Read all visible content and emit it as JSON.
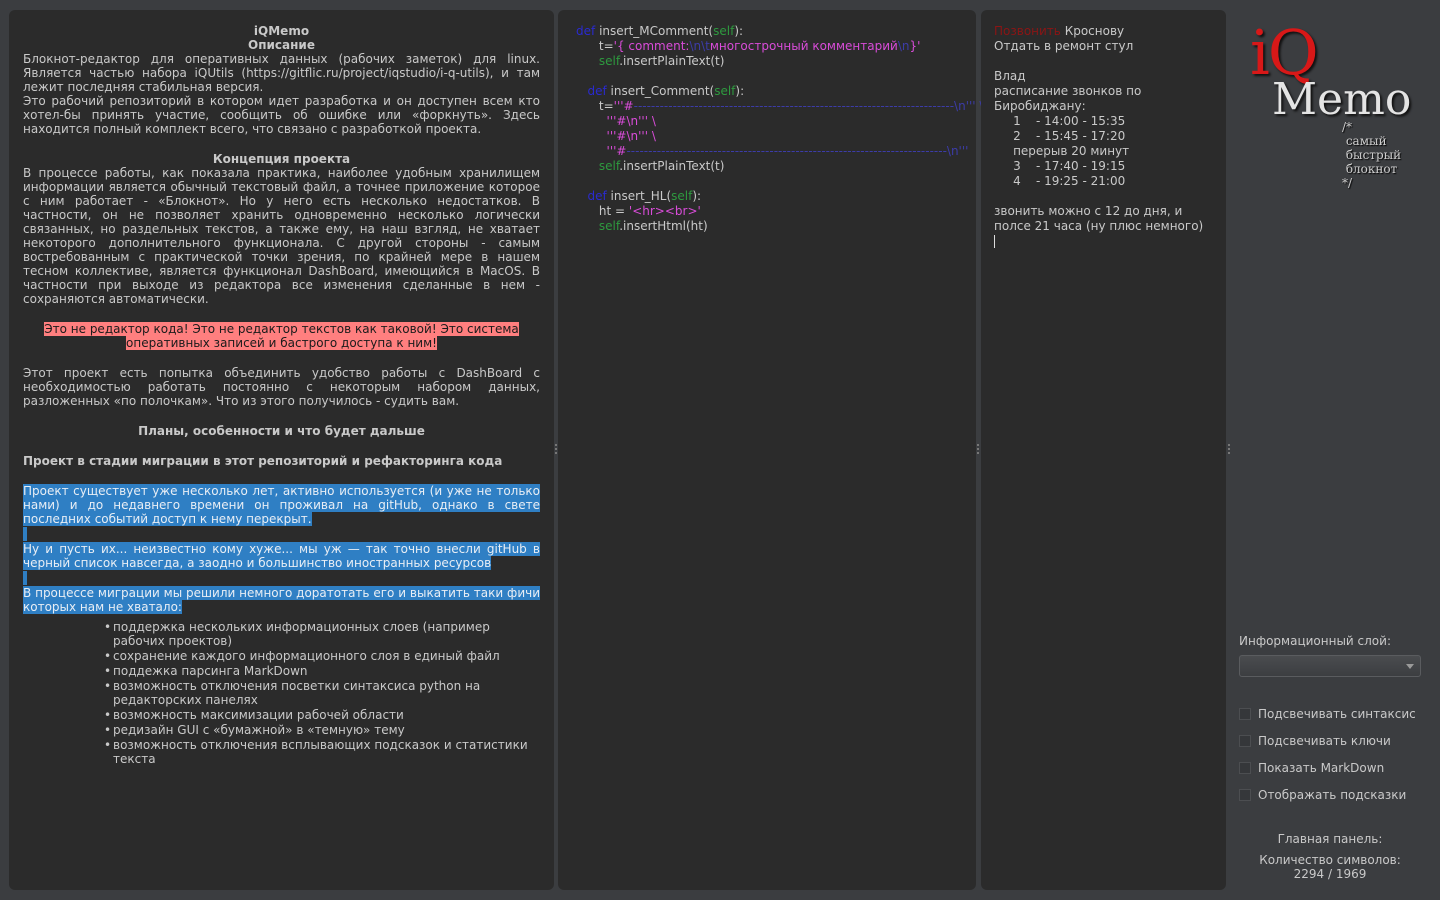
{
  "left_doc": {
    "title": "iQMemo",
    "desc_heading": "Описание",
    "desc_p1": "Блокнот-редактор для оперативных данных (рабочих заметок) для linux. Является частью набора iQUtils (https://gitflic.ru/project/iqstudio/i-q-utils), и там лежит последняя стабильная версия.",
    "desc_p2": "Это рабочий репозиторий в котором идет разработка и он доступен всем кто хотел-бы принять участие, сообщить об ошибке или «форкнуть». Здесь находится полный комплект всего, что связано с разработкой проекта.",
    "concept_heading": "Концепция проекта",
    "concept_p": "В процессе работы, как показала практика, наиболее удобным хранилищем информации является обычный текстовый файл, а точнее приложение которое с ним работает - «Блокнот». Но у него есть несколько недостатков. В частности, он не позволяет хранить одновременно несколько логически связанных, но раздельных текстов, а также ему, на наш взгляд, не хватает некоторого дополнительного функционала. С другой стороны - самым востребованным с практической точки зрения, по крайней мере в нашем тесном коллективе, является функционал DashBoard, имеющийся в MacOS. В частности при выходе из редактора все изменения сделанные в нем - сохраняются автоматически.",
    "warn_line1": "Это не редактор кода! Это не редактор текстов как таковой! Это система",
    "warn_line2": "оперативных записей и бастрого доступа к ним!",
    "unite_p": "Этот проект есть попытка объединить удобство работы с DashBoard с необходимостью работать постоянно с некоторым набором данных, разложенных «по полочкам». Что из этого получилось - судить вам.",
    "plans_heading": "Планы, особенности и что будет дальше",
    "migration_heading": "Проект в стадии миграции в этот репозиторий и рефакторинга кода",
    "sel_p1": "Проект существует уже несколько лет, активно используется (и уже не только нами) и до недавнего времени он проживал на gitHub, однако в свете последних событий доступ к нему перекрыт.",
    "sel_p2": "Ну и пусть их... неизвестно кому хуже... мы уж — так точно внесли gitHub в черный список навсегда, а заодно и большинство иностранных ресурсов",
    "sel_p3": "В процессе миграции мы решили немного доратотать его и выкатить таки фичи которых нам не хватало:",
    "features": [
      "поддержка нескольких информационных слоев (например рабочих проектов)",
      "сохранение каждого информационного слоя в единый файл",
      "поддежка парсинга MarkDown",
      "возможность отключения посветки синтаксиса python на редакторских панелях",
      "возможность максимизации рабочей области",
      "редизайн GUI с «бумажной» в «темную» тему",
      "возможность отключения всплывающих подсказок и статистики текста"
    ]
  },
  "code": {
    "def": "def",
    "self": "self",
    "fn1": "insert_MComment(",
    "fn1_close": "):",
    "l2_pre": "t=",
    "l2_q1": "'{ comment:",
    "l2_nt": "\\n\\t",
    "l2_text": "многострочный комментарий",
    "l2_n": "\\n",
    "l2_q2": "}'",
    "l3": ".insertPlainText(t)",
    "fn2": "insert_Comment(",
    "l5_pre": "t=",
    "l5_str": "'''#",
    "l5_rule": "--------------------------------------------------------------------------",
    "l5_end": "\\n''' \\",
    "l6": "'''#\\n''' \\",
    "l7": "'''#\\n''' \\",
    "l8_str": "'''#",
    "l8_rule": "--------------------------------------------------------------------------",
    "l8_end": "\\n'''",
    "fn3": "insert_HL(",
    "l11_pre": "ht = ",
    "l11_str": "'<hr><br>'",
    "l12": ".insertHtml(ht)"
  },
  "notes": {
    "l1_red": "Позвонить",
    "l1_rest": " Кроснову",
    "l2": "Отдать в ремонт стул",
    "l3": "Влад",
    "l4": "расписание звонков по",
    "l5": "Биробиджану:",
    "l6": "     1    - 14:00 - 15:35",
    "l7": "     2    - 15:45 - 17:20",
    "l8": "     перерыв 20 минут",
    "l9": "     3    - 17:40 - 19:15",
    "l10": "     4    - 19:25 - 21:00",
    "l11": "звонить можно с 12 до дня, и",
    "l12": "полсе 21 часа (ну плюс немного)"
  },
  "logo": {
    "iq": "iQ",
    "memo": "Memo",
    "tag1": "/*",
    "tag2": " самый",
    "tag3": " быстрый",
    "tag4": " блокнот",
    "tag5": "*/"
  },
  "sidebar": {
    "layer_label": "Информационный слой:",
    "layer_value": "",
    "options": [
      {
        "label": "Подсвечивать синтаксис",
        "checked": false
      },
      {
        "label": "Подсвечивать ключи",
        "checked": false
      },
      {
        "label": "Показать MarkDown",
        "checked": false
      },
      {
        "label": "Отображать подсказки",
        "checked": false
      }
    ],
    "main_panel_label": "Главная панель:",
    "chars_label": "Количество символов:",
    "chars_value": "2294 / 1969"
  },
  "colors": {
    "background": "#3b3d40",
    "panel": "#2b2b2b",
    "selection": "#2f7fc4",
    "warning_highlight": "#ff7f7f",
    "keyword": "#2a2ad0",
    "self": "#2e9a3f",
    "string": "#d94cd9",
    "logo_red": "#d81818"
  }
}
